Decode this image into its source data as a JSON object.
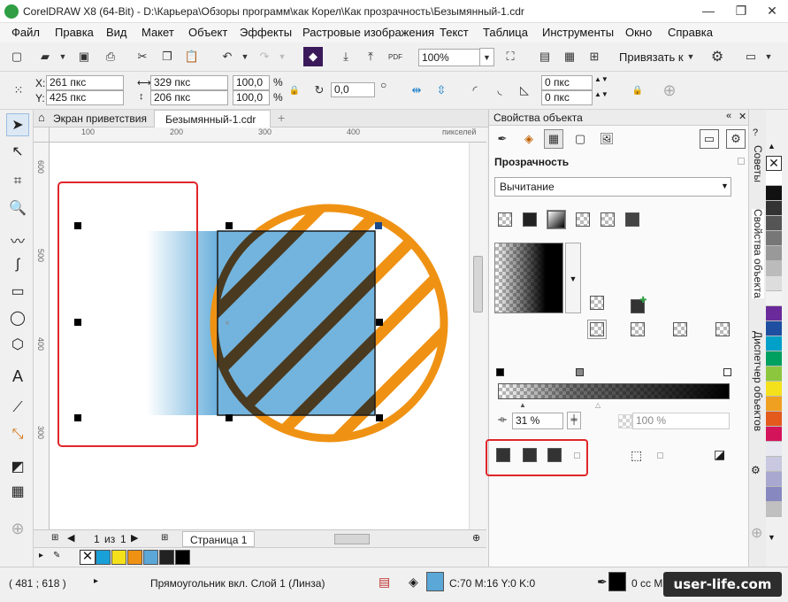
{
  "window": {
    "title": "CorelDRAW X8 (64-Bit) - D:\\Карьера\\Обзоры программ\\как Корел\\Как прозрачность\\Безымянный-1.cdr",
    "minimize": "—",
    "restore": "❐",
    "close": "✕"
  },
  "menu": [
    "Файл",
    "Правка",
    "Вид",
    "Макет",
    "Объект",
    "Эффекты",
    "Растровые изображения",
    "Текст",
    "Таблица",
    "Инструменты",
    "Окно",
    "Справка"
  ],
  "toolbar": {
    "zoom_value": "100%",
    "snap_label": "Привязать к",
    "pdf_label": "PDF"
  },
  "property_bar": {
    "x_label": "X:",
    "x_value": "261 пкс",
    "y_label": "Y:",
    "y_value": "425 пкс",
    "width_value": "329 пкс",
    "height_value": "206 пкс",
    "scale_x": "100,0",
    "scale_y": "100,0",
    "percent": "%",
    "rotation": "0,0",
    "outline_1": "0 пкс",
    "outline_2": "0 пкс"
  },
  "doc_tabs": [
    "Экран приветствия",
    "Безымянный-1.cdr"
  ],
  "ruler": {
    "h_ticks": [
      "100",
      "200",
      "300",
      "400"
    ],
    "unit": "пикселей",
    "v_ticks": [
      "600",
      "500",
      "400",
      "300"
    ]
  },
  "page_nav": {
    "current": "1",
    "of_label": "из",
    "total": "1",
    "page_tab": "Страница 1"
  },
  "docker": {
    "title": "Свойства объекта",
    "section": "Прозрачность",
    "merge_mode": "Вычитание",
    "node_position": "31 %",
    "opacity": "100 %"
  },
  "side_tabs": [
    "Советы",
    "Свойства объекта",
    "Диспетчер объектов"
  ],
  "status": {
    "coords": "( 481  ; 618  )",
    "object_info": "Прямоугольник вкл. Слой 1  (Линза)",
    "fill_info": "C:70 M:16 Y:0 K:0",
    "outline_info": "0 сс  M"
  },
  "watermark": "user-life.com",
  "colors": {
    "accent_orange": "#ef9214",
    "rect_blue": "#5aa7d8",
    "selection_red": "#e0262a",
    "status_fill": "#5aa7d8"
  },
  "doc_palette": [
    "#1aa0d8",
    "#f5e11b",
    "#ef9214",
    "#5aa7d8",
    "#222222",
    "#000000"
  ],
  "right_palette": [
    "#ffffff",
    "#111111",
    "#333333",
    "#555555",
    "#777777",
    "#999999",
    "#bbbbbb",
    "#dddddd",
    "#f2f2f2",
    "#6a2a9a",
    "#1e4fa0",
    "#00a0c8",
    "#00a060",
    "#8cc63f",
    "#f5e11b",
    "#f0a020",
    "#e35a1c",
    "#d4145a",
    "#e8e8f0",
    "#c8c8e0",
    "#a8a8d0",
    "#8888c0",
    "#c0c0c0"
  ]
}
